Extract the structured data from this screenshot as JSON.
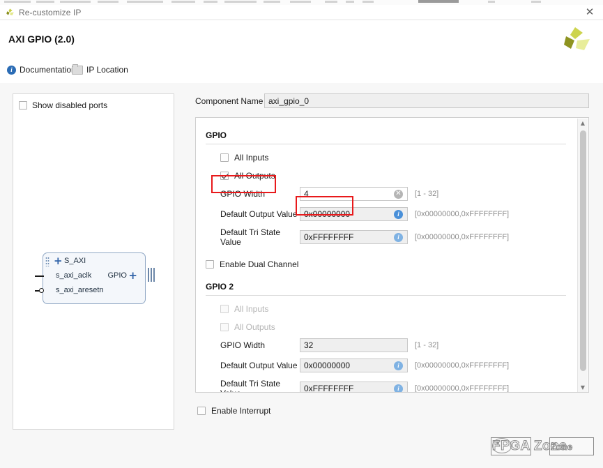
{
  "window": {
    "title": "Re-customize IP",
    "close_label": "✕",
    "logo_icon": "vivado-logo-icon"
  },
  "header": {
    "ip_title": "AXI GPIO (2.0)"
  },
  "links": [
    {
      "label": "Documentation",
      "icon": "info-icon"
    },
    {
      "label": "IP Location",
      "icon": "folder-icon"
    }
  ],
  "left_panel": {
    "show_disabled_ports": {
      "label": "Show disabled ports",
      "checked": false
    },
    "block_diagram": {
      "bus_port": "S_AXI",
      "ports": [
        "s_axi_aclk",
        "s_axi_aresetn"
      ],
      "output_port": "GPIO",
      "plus_glyph": "+"
    }
  },
  "component": {
    "label": "Component Name",
    "value": "axi_gpio_0"
  },
  "settings": {
    "gpio": {
      "group_title": "GPIO",
      "all_inputs": {
        "label": "All Inputs",
        "checked": false
      },
      "all_outputs": {
        "label": "All Outputs",
        "checked": true
      },
      "gpio_width": {
        "label": "GPIO Width",
        "value": "4",
        "range": "[1 - 32]",
        "icon": "clear-icon",
        "icon_glyph": "✕"
      },
      "default_output_value": {
        "label": "Default Output Value",
        "value": "0x00000000",
        "range": "[0x00000000,0xFFFFFFFF]",
        "icon": "info-icon",
        "icon_glyph": "i"
      },
      "default_tri_state_value": {
        "label": "Default Tri State Value",
        "value": "0xFFFFFFFF",
        "range": "[0x00000000,0xFFFFFFFF]",
        "icon": "info-icon",
        "icon_glyph": "i"
      }
    },
    "enable_dual_channel": {
      "label": "Enable Dual Channel",
      "checked": false
    },
    "gpio2": {
      "group_title": "GPIO 2",
      "all_inputs": {
        "label": "All Inputs",
        "checked": false
      },
      "all_outputs": {
        "label": "All Outputs",
        "checked": false
      },
      "gpio_width": {
        "label": "GPIO Width",
        "value": "32",
        "range": "[1 - 32]"
      },
      "default_output_value": {
        "label": "Default Output Value",
        "value": "0x00000000",
        "range": "[0x00000000,0xFFFFFFFF]",
        "icon": "info-icon",
        "icon_glyph": "i"
      },
      "default_tri_state_value": {
        "label": "Default Tri State Value",
        "value": "0xFFFFFFFF",
        "range": "[0x00000000,0xFFFFFFFF]",
        "icon": "info-icon",
        "icon_glyph": "i"
      }
    }
  },
  "enable_interrupt": {
    "label": "Enable Interrupt",
    "checked": false
  },
  "scrollbar": {
    "up_glyph": "▲",
    "down_glyph": "▼"
  },
  "watermark": {
    "main_text": "FPGA Zone",
    "sub_text": "Zone"
  },
  "colors": {
    "annotation_red": "#e8191b",
    "accent_blue": "#2f62a8",
    "info_blue": "#4a90d9",
    "panel_bg": "#f7f7f7",
    "field_disabled": "#efefef"
  }
}
